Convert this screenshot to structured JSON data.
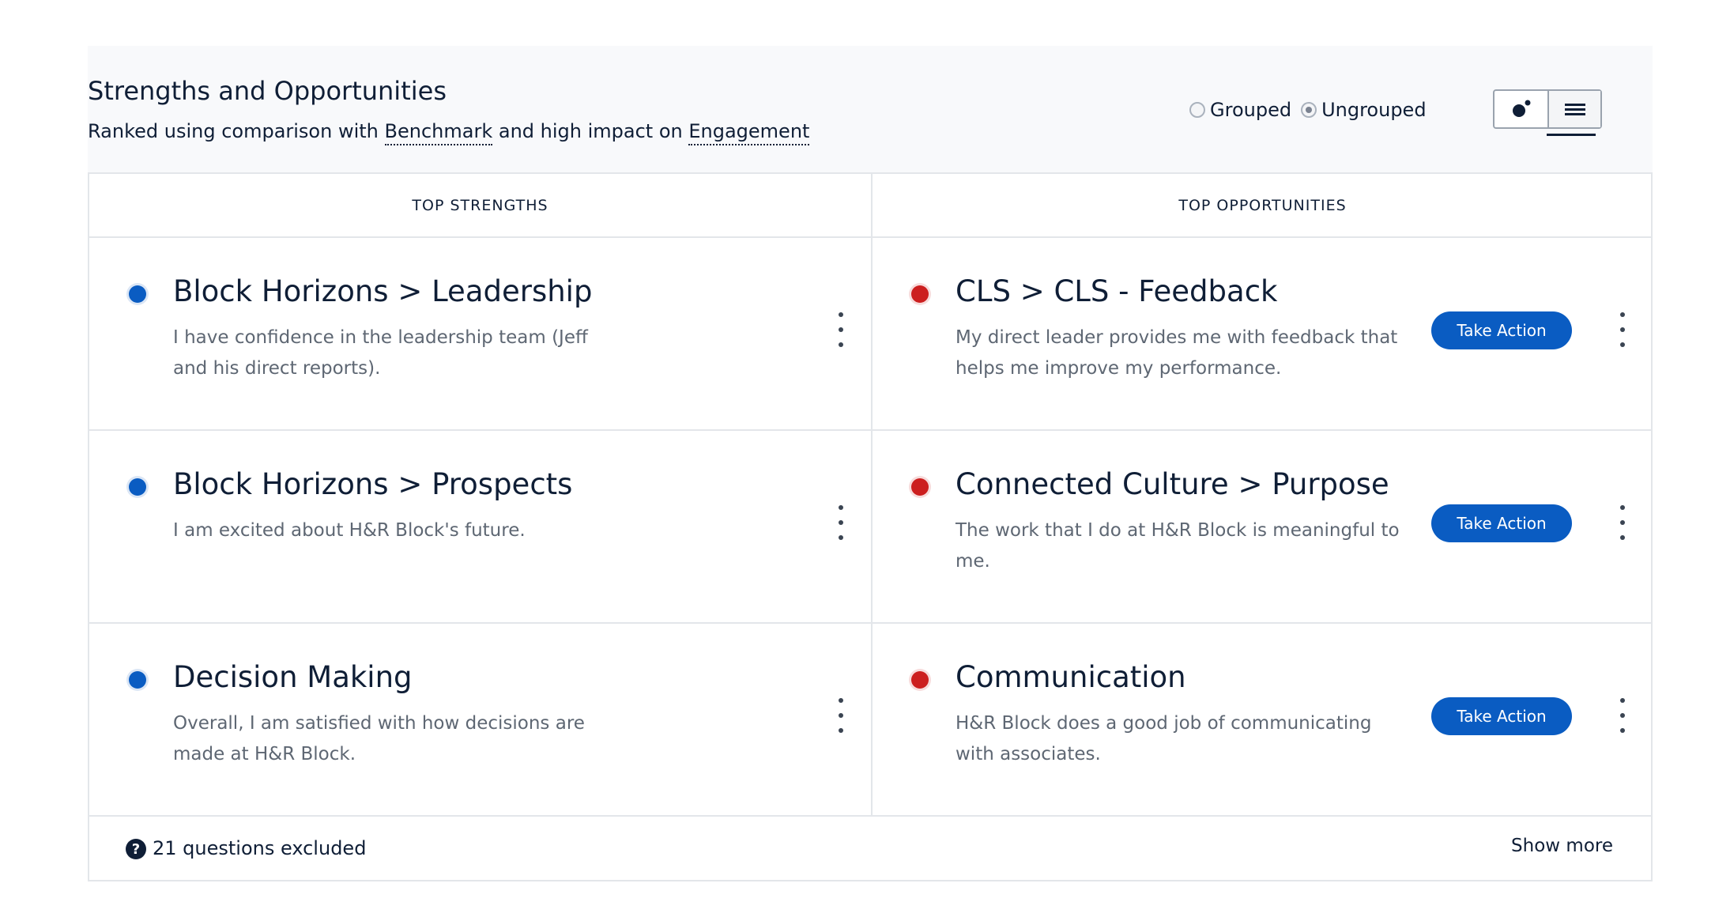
{
  "header": {
    "title": "Strengths and Opportunities",
    "subtitle_prefix": "Ranked using comparison with",
    "subtitle_link1": "Benchmark",
    "subtitle_middle": "and high impact on",
    "subtitle_link2": "Engagement"
  },
  "grouping": {
    "options": [
      {
        "label": "Grouped",
        "selected": false
      },
      {
        "label": "Ungrouped",
        "selected": true
      }
    ]
  },
  "view_toggle": {
    "options": [
      "scatter-view-icon",
      "list-view-icon"
    ],
    "active": "list-view-icon"
  },
  "columns": {
    "strengths": "TOP STRENGTHS",
    "opportunities": "TOP OPPORTUNITIES"
  },
  "strengths": [
    {
      "title": "Block Horizons > Leadership",
      "desc1": "I have confidence in the leadership team (Jeff",
      "desc2": "and his direct reports)."
    },
    {
      "title": "Block Horizons > Prospects",
      "desc1": "I am excited about H&R Block's future.",
      "desc2": ""
    },
    {
      "title": "Decision Making",
      "desc1": "Overall, I am satisfied with how decisions are",
      "desc2": "made at H&R Block."
    }
  ],
  "opportunities": [
    {
      "title": "CLS > CLS - Feedback",
      "desc1": "My direct leader provides me with feedback that",
      "desc2": "helps me improve my performance.",
      "action": "Take Action"
    },
    {
      "title": "Connected Culture > Purpose",
      "desc1": "The work that I do at H&R Block is meaningful to",
      "desc2": "me.",
      "action": "Take Action"
    },
    {
      "title": "Communication",
      "desc1": "H&R Block does a good job of communicating",
      "desc2": "with associates.",
      "action": "Take Action"
    }
  ],
  "footer": {
    "help_icon": "?",
    "excluded_text": "21 questions excluded",
    "show_more": "Show more"
  },
  "colors": {
    "strength_dot": "#0a5cc2",
    "opportunity_dot": "#cc1f1f",
    "button": "#0a5cc2"
  }
}
